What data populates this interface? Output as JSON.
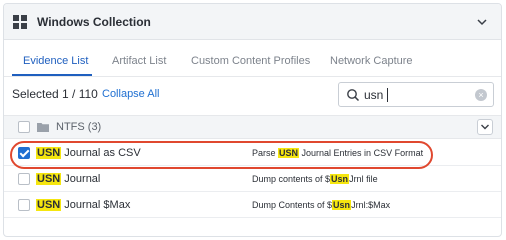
{
  "panel": {
    "title": "Windows Collection"
  },
  "tabs": [
    {
      "label": "Evidence List",
      "active": true
    },
    {
      "label": "Artifact List",
      "active": false
    },
    {
      "label": "Custom Content Profiles",
      "active": false
    },
    {
      "label": "Network Capture",
      "active": false
    }
  ],
  "toolbar": {
    "selected_label": "Selected 1 / 110",
    "collapse_label": "Collapse All"
  },
  "search": {
    "value": "usn"
  },
  "group": {
    "label": "NTFS (3)",
    "checked": false
  },
  "items": [
    {
      "name_highlight": "USN",
      "name_rest": " Journal as CSV",
      "desc_before": "Parse ",
      "desc_highlight": "USN",
      "desc_after": " Journal Entries in CSV Format",
      "checked": true
    },
    {
      "name_highlight": "USN",
      "name_rest": " Journal",
      "desc_before": "Dump contents of $",
      "desc_highlight": "Usn",
      "desc_after": "Jrnl file",
      "checked": false
    },
    {
      "name_highlight": "USN",
      "name_rest": " Journal $Max",
      "desc_before": "Dump Contents of $",
      "desc_highlight": "Usn",
      "desc_after": "Jrnl:$Max",
      "checked": false
    }
  ],
  "colors": {
    "accent": "#1f6fd1",
    "search_highlight": "#f5e60f",
    "annotation_oval": "#e0482f"
  }
}
